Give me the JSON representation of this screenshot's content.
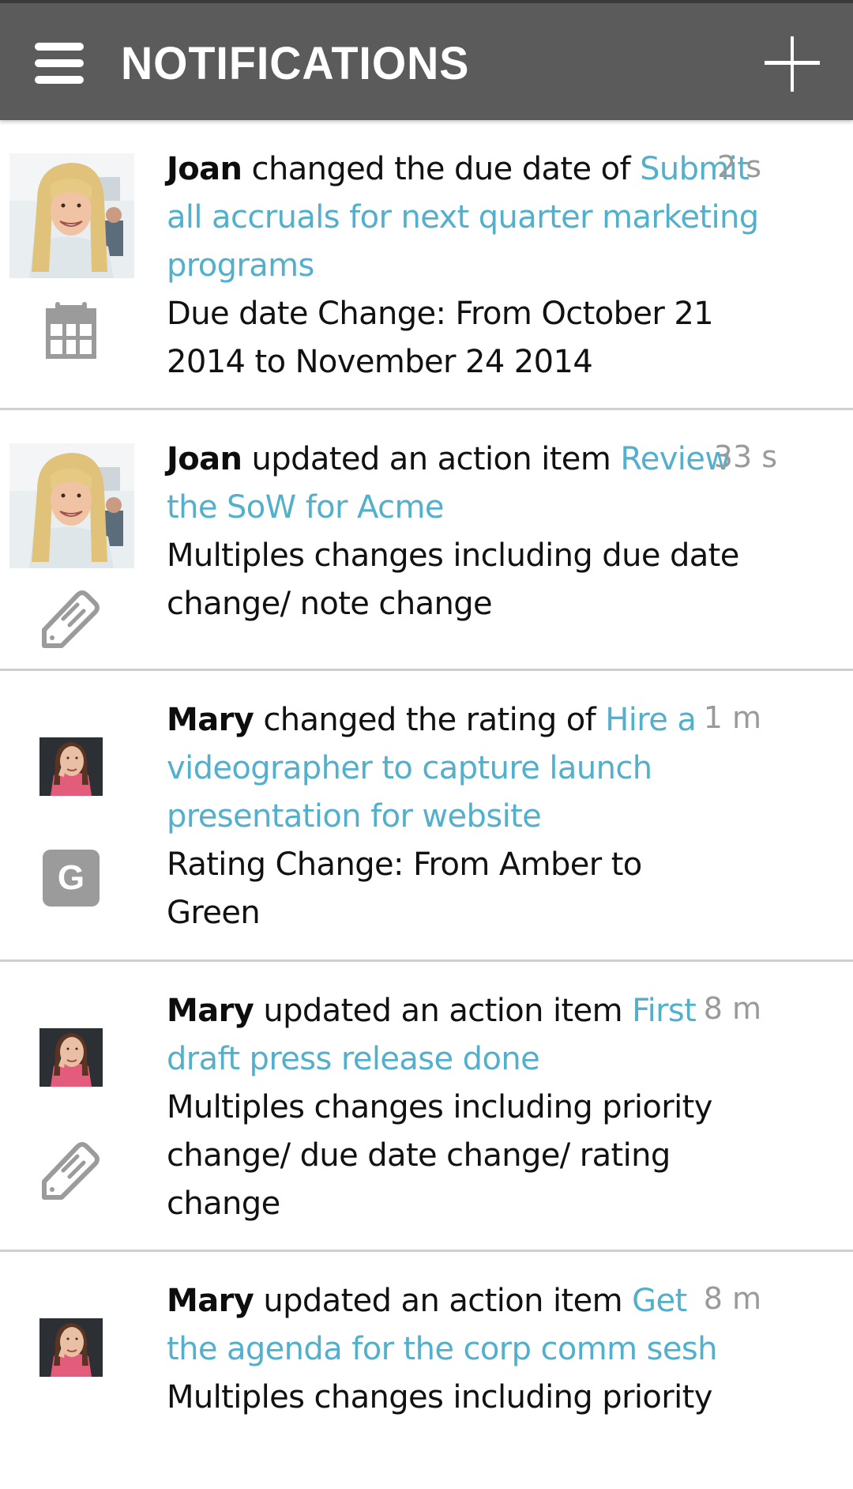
{
  "header": {
    "title": "NOTIFICATIONS",
    "menu_icon": "hamburger-menu-icon",
    "add_icon": "plus-icon"
  },
  "colors": {
    "header_bg": "#5b5b5b",
    "link": "#52b0cc",
    "timestamp": "#9a9a9a",
    "icon_gray": "#9b9b9b"
  },
  "notifications": [
    {
      "actor": "Joan",
      "action": " changed the due date of ",
      "item": "Submit all accruals for next quarter marketing programs",
      "detail": "Due date Change: From October 21 2014 to November 24 2014",
      "time": "2 s",
      "type_icon": "calendar-icon"
    },
    {
      "actor": "Joan",
      "action": " updated an action item ",
      "item": "Review the SoW for Acme",
      "detail": "Multiples changes including due date change/ note change",
      "time": "33 s",
      "type_icon": "pencil-icon"
    },
    {
      "actor": "Mary",
      "action": " changed the rating of ",
      "item": "Hire a videographer to capture launch presentation for website",
      "detail": "Rating Change: From Amber to Green",
      "time": "1 m",
      "type_icon": "rating-badge-icon",
      "badge_letter": "G"
    },
    {
      "actor": "Mary",
      "action": " updated an action item ",
      "item": "First draft press release done",
      "detail": "Multiples changes including priority change/ due date change/ rating change",
      "time": "8 m",
      "type_icon": "pencil-icon"
    },
    {
      "actor": "Mary",
      "action": " updated an action item ",
      "item": "Get the agenda for the corp comm sesh",
      "detail": "Multiples changes including priority",
      "time": "8 m",
      "type_icon": "pencil-icon"
    }
  ]
}
